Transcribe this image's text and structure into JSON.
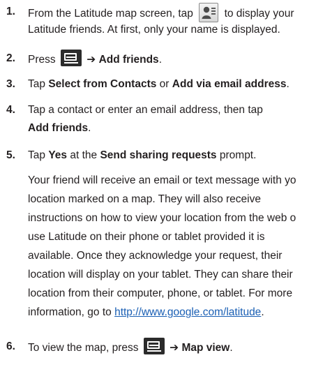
{
  "steps": [
    {
      "num": "1.",
      "l1a": "From the Latitude map screen, tap",
      "icon": "friends-list-icon",
      "l1b": "to display your",
      "l2": "Latitude friends. At first, only your name is displayed."
    },
    {
      "num": "2.",
      "a": "Press",
      "icon": "menu-icon",
      "arrow": "➔",
      "b": "Add friends",
      "c": "."
    },
    {
      "num": "3.",
      "a": "Tap",
      "b": "Select from Contacts",
      "c": "or",
      "d": "Add via email address",
      "e": "."
    },
    {
      "num": "4.",
      "a": "Tap a contact or enter an email address, then tap",
      "b": "Add friends",
      "c": "."
    },
    {
      "num": "5.",
      "a": "Tap",
      "b": "Yes",
      "c": "at the",
      "d": "Send sharing requests",
      "e": "prompt."
    },
    {
      "num": "6.",
      "a": "To view the map, press",
      "icon": "menu-icon",
      "arrow": "➔",
      "b": "Map view",
      "c": "."
    }
  ],
  "paragraph": {
    "lines": [
      "Your friend will receive an email or text message with yo",
      "location marked on a map. They will also receive",
      "instructions on how to view your location from the web o",
      "use Latitude on their phone or tablet provided it is",
      "available. Once they acknowledge your request, their",
      "location will display on your tablet. They can share their",
      "location from their computer, phone, or tablet. For more"
    ],
    "last_prefix": "information, go to",
    "link": "http://www.google.com/latitude",
    "last_suffix": "."
  }
}
